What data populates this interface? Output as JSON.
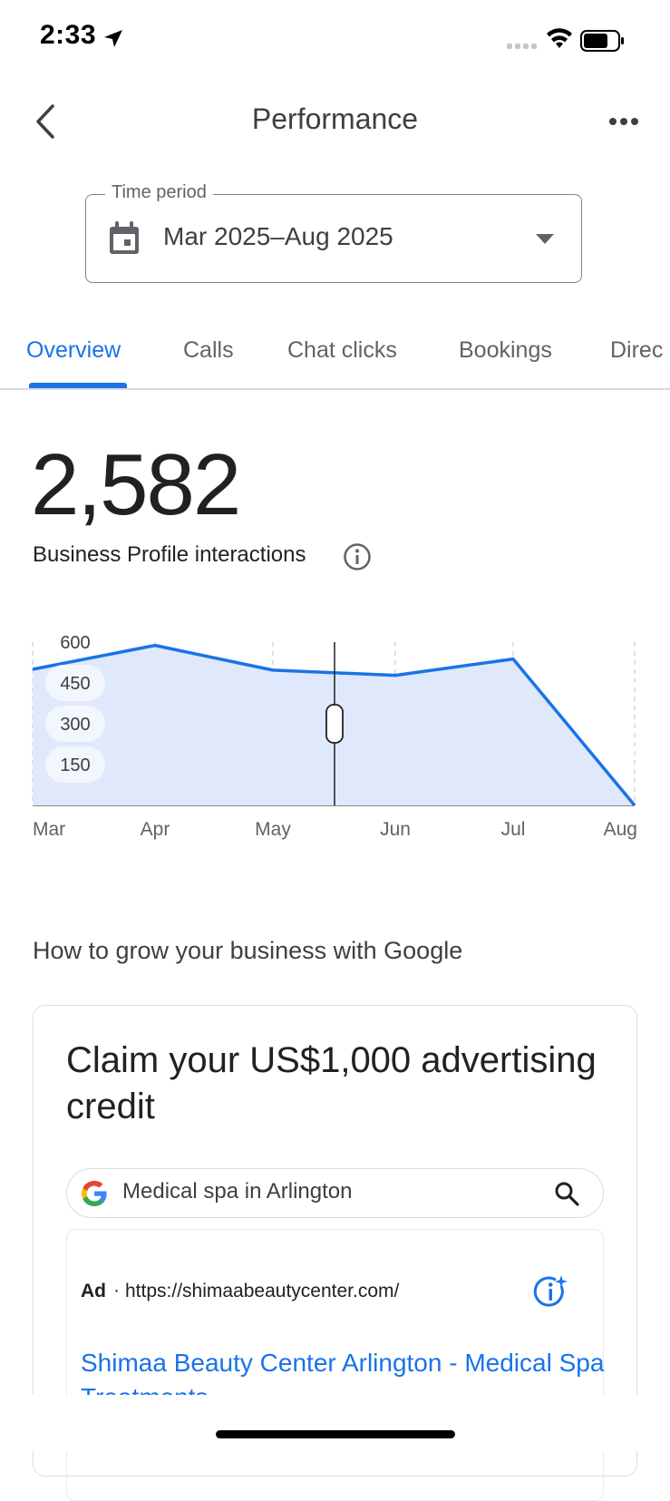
{
  "status_bar": {
    "time": "2:33"
  },
  "header": {
    "title": "Performance"
  },
  "time_period": {
    "label": "Time period",
    "value": "Mar 2025–Aug 2025"
  },
  "tabs": [
    {
      "label": "Overview",
      "active": true
    },
    {
      "label": "Calls",
      "active": false
    },
    {
      "label": "Chat clicks",
      "active": false
    },
    {
      "label": "Bookings",
      "active": false
    },
    {
      "label": "Direc",
      "active": false
    }
  ],
  "metric": {
    "value": "2,582",
    "label": "Business Profile interactions"
  },
  "chart_data": {
    "type": "area",
    "x": [
      "Mar",
      "Apr",
      "May",
      "Jun",
      "Jul",
      "Aug"
    ],
    "values": [
      500,
      588,
      497,
      478,
      538,
      0
    ],
    "ylim": [
      0,
      600
    ],
    "yticks": [
      "150",
      "300",
      "450",
      "600"
    ],
    "grid": "vertical dashed",
    "colors": {
      "line": "#1a73e8",
      "fill": "#dfe9fb"
    }
  },
  "grow_section": {
    "title": "How to grow your business with Google",
    "card_title": "Claim your US$1,000 advertising credit",
    "search_query": "Medical spa in Arlington",
    "ad": {
      "badge": "Ad",
      "separator": "·",
      "url": "https://shimaabeautycenter.com/",
      "headline": "Shimaa Beauty Center Arlington - Medical Spa Treatments"
    }
  },
  "colors": {
    "accent": "#1a73e8",
    "text": "#202124",
    "muted": "#5f6368",
    "border": "#dadce0"
  }
}
